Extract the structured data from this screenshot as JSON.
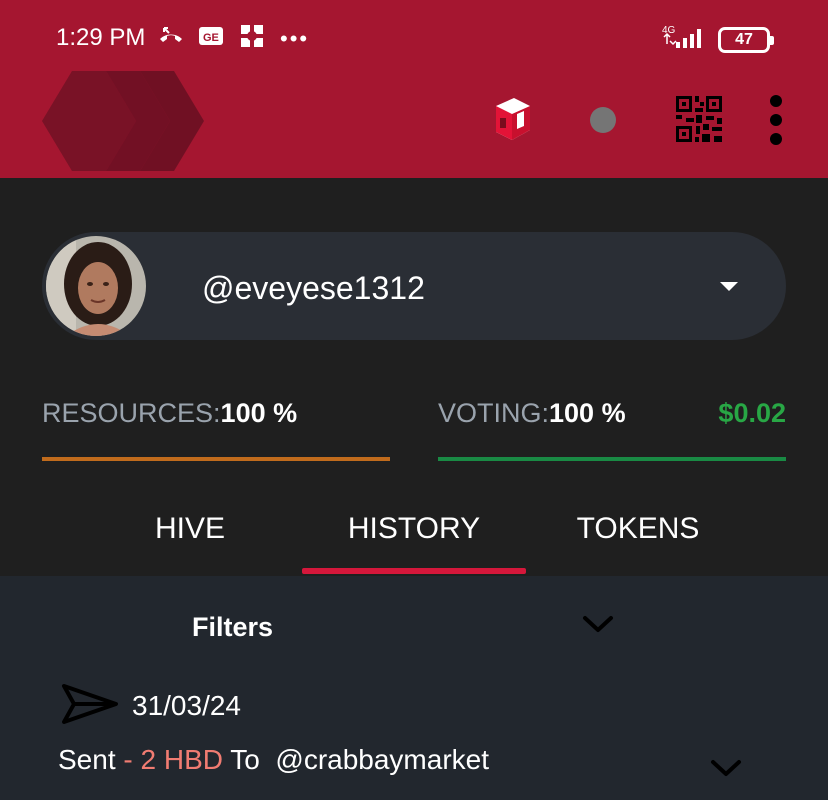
{
  "status_bar": {
    "time": "1:29 PM",
    "network": "4G",
    "battery": "47"
  },
  "account": {
    "username": "@eveyese1312"
  },
  "meters": {
    "resources": {
      "label": "RESOURCES:",
      "value": "100 %",
      "color": "#c06b1c"
    },
    "voting": {
      "label": "VOTING:",
      "value": "100 %",
      "color": "#198a44"
    },
    "voting_value": "$0.02"
  },
  "tabs": [
    {
      "label": "HIVE"
    },
    {
      "label": "HISTORY",
      "active": true
    },
    {
      "label": "TOKENS"
    }
  ],
  "filters": {
    "label": "Filters"
  },
  "transaction": {
    "date": "31/03/24",
    "type": "Sent",
    "separator": " - ",
    "amount": "2 HBD",
    "to": "To",
    "recipient": "@crabbaymarket"
  },
  "colors": {
    "brand": "#a51630",
    "accent": "#d5173b",
    "amount": "#f17c72",
    "positive": "#28a745"
  }
}
